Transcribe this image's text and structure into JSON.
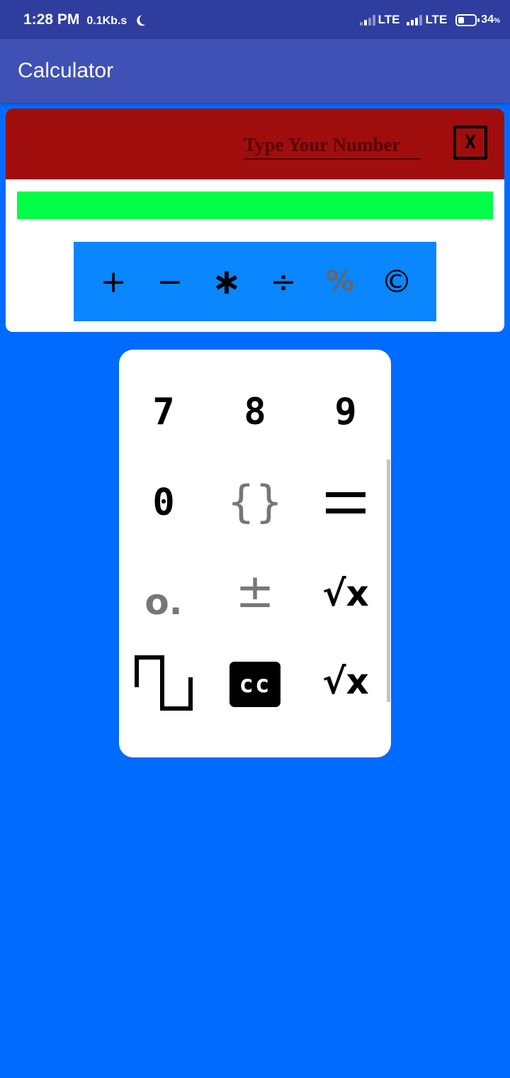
{
  "status_bar": {
    "time": "1:28 PM",
    "speed": "0.1Kb.s",
    "network_1": "LTE",
    "network_2": "LTE",
    "battery": "34",
    "battery_unit": "%"
  },
  "app_bar": {
    "title": "Calculator"
  },
  "input": {
    "value": "",
    "placeholder": "Type Your Number",
    "clear_label": "X"
  },
  "operators": [
    {
      "name": "plus",
      "symbol": "+"
    },
    {
      "name": "minus",
      "symbol": "−"
    },
    {
      "name": "multiply",
      "symbol": "∗"
    },
    {
      "name": "divide",
      "symbol": "÷"
    },
    {
      "name": "percent",
      "symbol": "%"
    },
    {
      "name": "copyright",
      "symbol": "©"
    }
  ],
  "keypad": {
    "key_7": "7",
    "key_8": "8",
    "key_9": "9",
    "key_0": "0",
    "braces": "{}",
    "decimal": "o.",
    "plus_minus": "±",
    "sqrt": "√x",
    "cc": "cc"
  },
  "colors": {
    "status_bar": "#2f3e9e",
    "app_bar": "#3f51b5",
    "background": "#006bff",
    "input_header": "#a00d0d",
    "result_bar": "#00ff48",
    "operator_bar": "#0a86ff"
  },
  "icons": {
    "clear": "close-box-icon",
    "square_wave": "square-wave-icon",
    "closed_captions": "closed-captions-icon"
  }
}
